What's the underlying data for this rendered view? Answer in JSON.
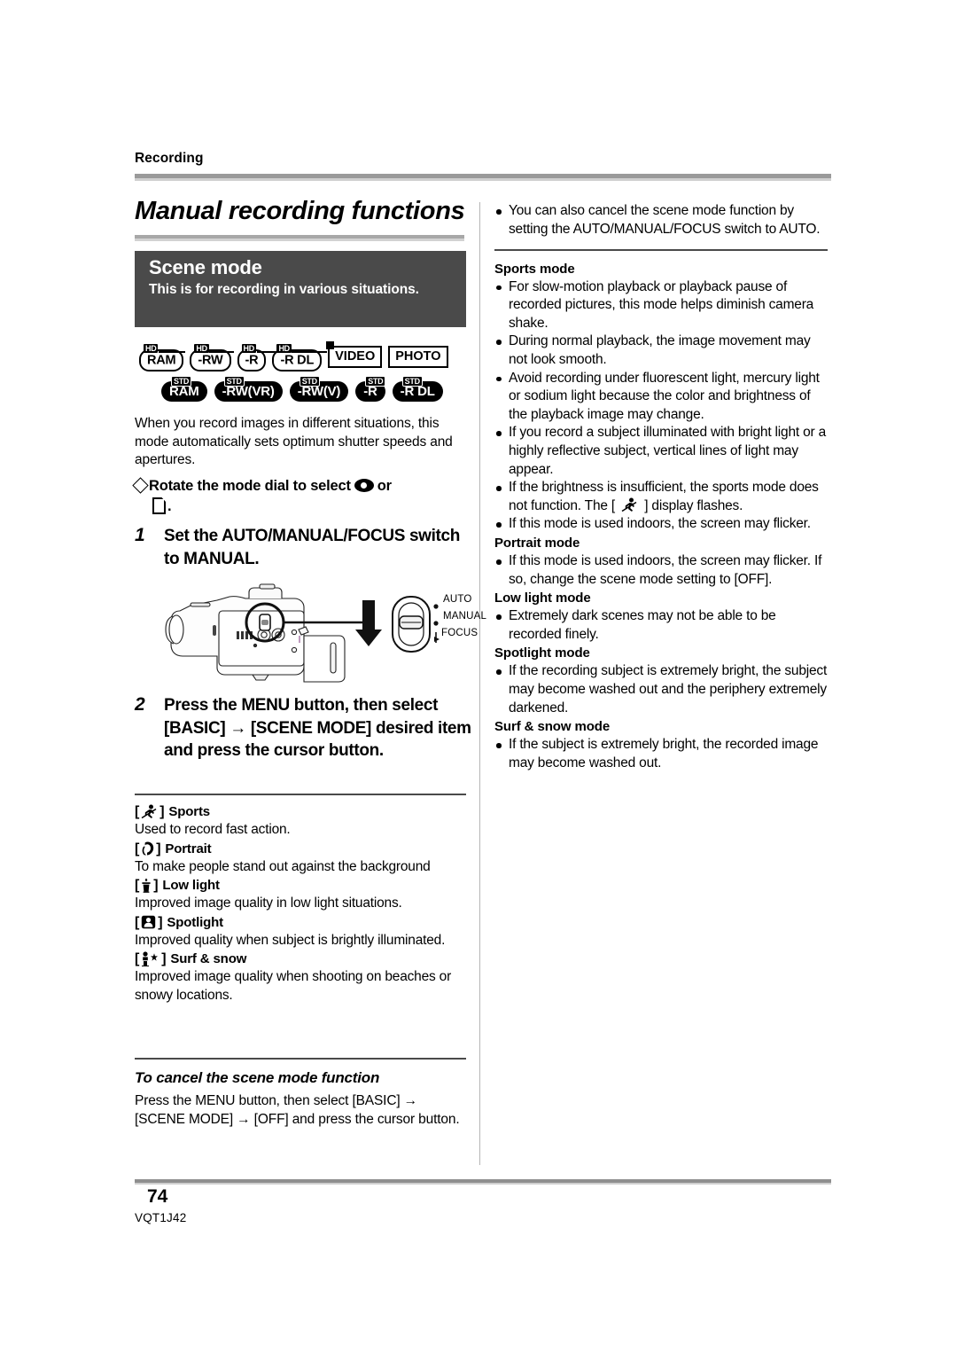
{
  "header": {
    "section_label": "Recording",
    "chapter_title": "Manual recording functions"
  },
  "scene_box": {
    "title": "Scene mode",
    "subtitle": "This is for recording in various situations."
  },
  "disc_badges": {
    "row1": [
      {
        "tag": "HD",
        "label": "RAM",
        "style": "hd-pill"
      },
      {
        "tag": "HD",
        "label": "-RW",
        "style": "hd-pill"
      },
      {
        "tag": "HD",
        "label": "-R",
        "style": "hd-pill"
      },
      {
        "tag": "HD",
        "label": "-R DL",
        "style": "hd-pill"
      },
      {
        "tag": "",
        "label": "VIDEO",
        "style": "square-video"
      },
      {
        "tag": "",
        "label": "PHOTO",
        "style": "square"
      }
    ],
    "row2": [
      {
        "tag": "STD",
        "label": "RAM",
        "style": "std-pill"
      },
      {
        "tag": "STD",
        "label": "-RW(VR)",
        "style": "std-pill"
      },
      {
        "tag": "STD",
        "label": "-RW(V)",
        "style": "std-pill"
      },
      {
        "tag": "STD",
        "label": "-R",
        "style": "std-pill"
      },
      {
        "tag": "STD",
        "label": "-R DL",
        "style": "std-pill"
      }
    ]
  },
  "left": {
    "lead": "When you record images in different situations, this mode automatically sets optimum shutter speeds and apertures.",
    "dial_text_before": "Rotate the mode dial to select",
    "dial_text_or": "or",
    "dial_text_after": ".",
    "step1_num": "1",
    "step1_text": "Set the AUTO/MANUAL/FOCUS switch to MANUAL.",
    "step2_num": "2",
    "step2_text": "Press the MENU button, then select [BASIC] → [SCENE MODE] desired item and press the cursor button.",
    "switch_labels": [
      "AUTO",
      "MANUAL",
      "FOCUS"
    ],
    "modes": [
      {
        "icon": "sports-icon",
        "name": "Sports",
        "desc": "Used to record fast action."
      },
      {
        "icon": "portrait-icon",
        "name": "Portrait",
        "desc": "To make people stand out against the background"
      },
      {
        "icon": "low-light-icon",
        "name": "Low light",
        "desc": "Improved image quality in low light situations."
      },
      {
        "icon": "spotlight-icon",
        "name": "Spotlight",
        "desc": "Improved quality when subject is brightly illuminated."
      },
      {
        "icon": "surf-snow-icon",
        "name": "Surf & snow",
        "desc": "Improved image quality when shooting on beaches or snowy locations."
      }
    ],
    "cancel_heading": "To cancel the scene mode function",
    "cancel_body": "Press the MENU button, then select [BASIC] → [SCENE MODE] → [OFF] and press the cursor button."
  },
  "right": {
    "intro_bullet": "You can also cancel the scene mode function by setting the AUTO/MANUAL/FOCUS switch to AUTO.",
    "sections": [
      {
        "heading": "Sports mode",
        "bullets": [
          "For slow-motion playback or playback pause of recorded pictures, this mode helps diminish camera shake.",
          "During normal playback, the image movement may not look smooth.",
          "Avoid recording under fluorescent light, mercury light or sodium light because the color and brightness of the playback image may change.",
          "If you record a subject illuminated with bright light or a highly reflective subject, vertical lines of light may appear.",
          "If this mode is used indoors, the screen may flicker."
        ],
        "icon_bullet": {
          "before": "If the brightness is insufficient, the sports mode does not function. The [",
          "after": "] display flashes."
        }
      },
      {
        "heading": "Portrait mode",
        "bullets": [
          "If this mode is used indoors, the screen may flicker. If so, change the scene mode setting to [OFF]."
        ]
      },
      {
        "heading": "Low light mode",
        "bullets": [
          "Extremely dark scenes may not be able to be recorded finely."
        ]
      },
      {
        "heading": "Spotlight mode",
        "bullets": [
          "If the recording subject is extremely bright, the subject may become washed out and the periphery extremely darkened."
        ]
      },
      {
        "heading": "Surf & snow mode",
        "bullets": [
          "If the subject is extremely bright, the recorded image may become washed out."
        ]
      }
    ]
  },
  "footer": {
    "page_number": "74",
    "doc_code": "VQT1J42"
  },
  "colors": {
    "scene_box_bg": "#4a4a4a",
    "rule_dark": "#9a9a9a",
    "rule_light": "#cfcfcf",
    "text": "#000000"
  }
}
